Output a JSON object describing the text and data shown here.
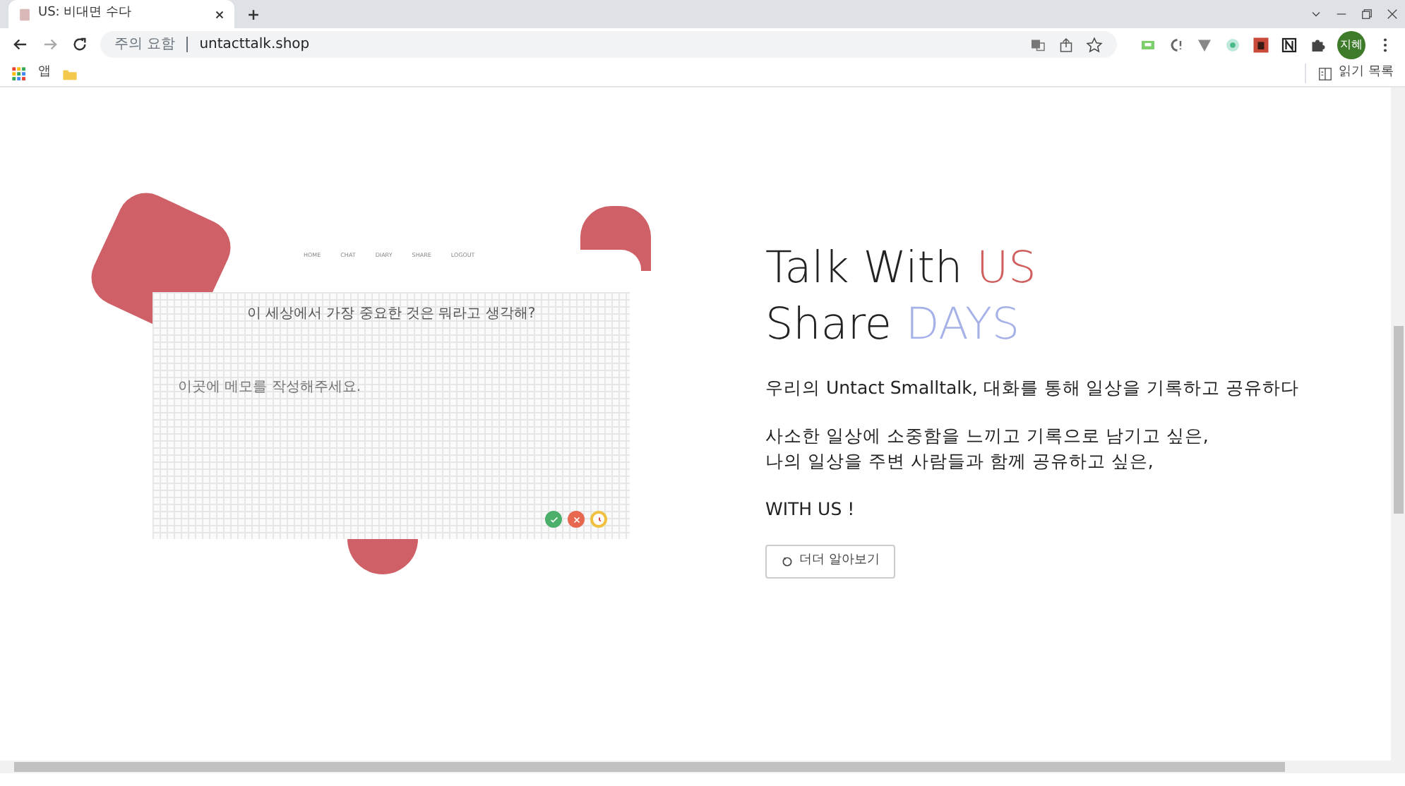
{
  "browser": {
    "tabs": [
      {
        "title": "US: 비대면 수다",
        "selected": true
      }
    ],
    "address": {
      "security": "주의 요함",
      "url": "untacttalk.shop"
    },
    "profile": "지혜",
    "bookmarks": [
      {
        "label": "앱"
      }
    ],
    "reading_list": "읽기 목록"
  },
  "mockup": {
    "nav": [
      "HOME",
      "CHAT",
      "DIARY",
      "SHARE",
      "LOGOUT"
    ],
    "question": "이 세상에서 가장 중요한 것은 뭐라고 생각해?",
    "placeholder": "이곳에 메모를 작성해주세요.",
    "actions": [
      {
        "kind": "confirm",
        "color": "#4caf6a"
      },
      {
        "kind": "cancel",
        "color": "#e8674f"
      },
      {
        "kind": "timer",
        "color": "#f0c040"
      }
    ]
  },
  "hero": {
    "headline": [
      {
        "lead": "Talk With",
        "accent": "US",
        "color": "#d0605f"
      },
      {
        "lead": "Share",
        "accent": "DAYS",
        "color": "#a6b1e8"
      }
    ],
    "paragraphs": [
      "우리의 Untact Smalltalk, 대화를 통해 일상을 기록하고 공유하다",
      "사소한 일상에 소중함을 느끼고 기록으로 남기고 싶은,\n나의 일상을 주변 사람들과 함께 공유하고 싶은,",
      "WITH US !"
    ],
    "button": "더더 알아보기"
  }
}
